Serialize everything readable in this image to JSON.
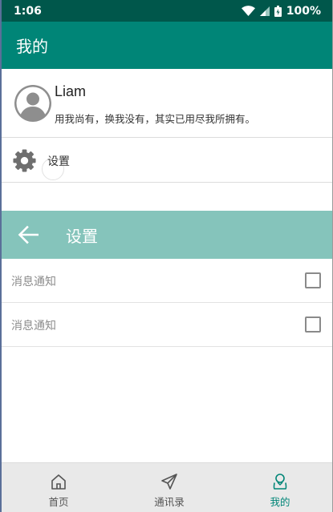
{
  "status_bar": {
    "time": "1:06",
    "battery": "100%"
  },
  "app_bar": {
    "title": "我的"
  },
  "profile": {
    "name": "Liam",
    "signature": "用我尚有，换我没有，其实已用尽我所拥有。"
  },
  "settings": {
    "label": "设置"
  },
  "settings_page": {
    "title": "设置",
    "rows": [
      {
        "label": "消息通知",
        "checked": false
      },
      {
        "label": "消息通知",
        "checked": false
      }
    ]
  },
  "bottom_nav": {
    "items": [
      {
        "label": "首页",
        "icon": "home-icon",
        "active": false
      },
      {
        "label": "通讯录",
        "icon": "paper-plane-icon",
        "active": false
      },
      {
        "label": "我的",
        "icon": "user-icon",
        "active": true
      }
    ]
  },
  "colors": {
    "status_bar": "#00574b",
    "primary": "#008577",
    "sub_bar": "#85c4bb",
    "nav_bg": "#e9e9e9"
  }
}
